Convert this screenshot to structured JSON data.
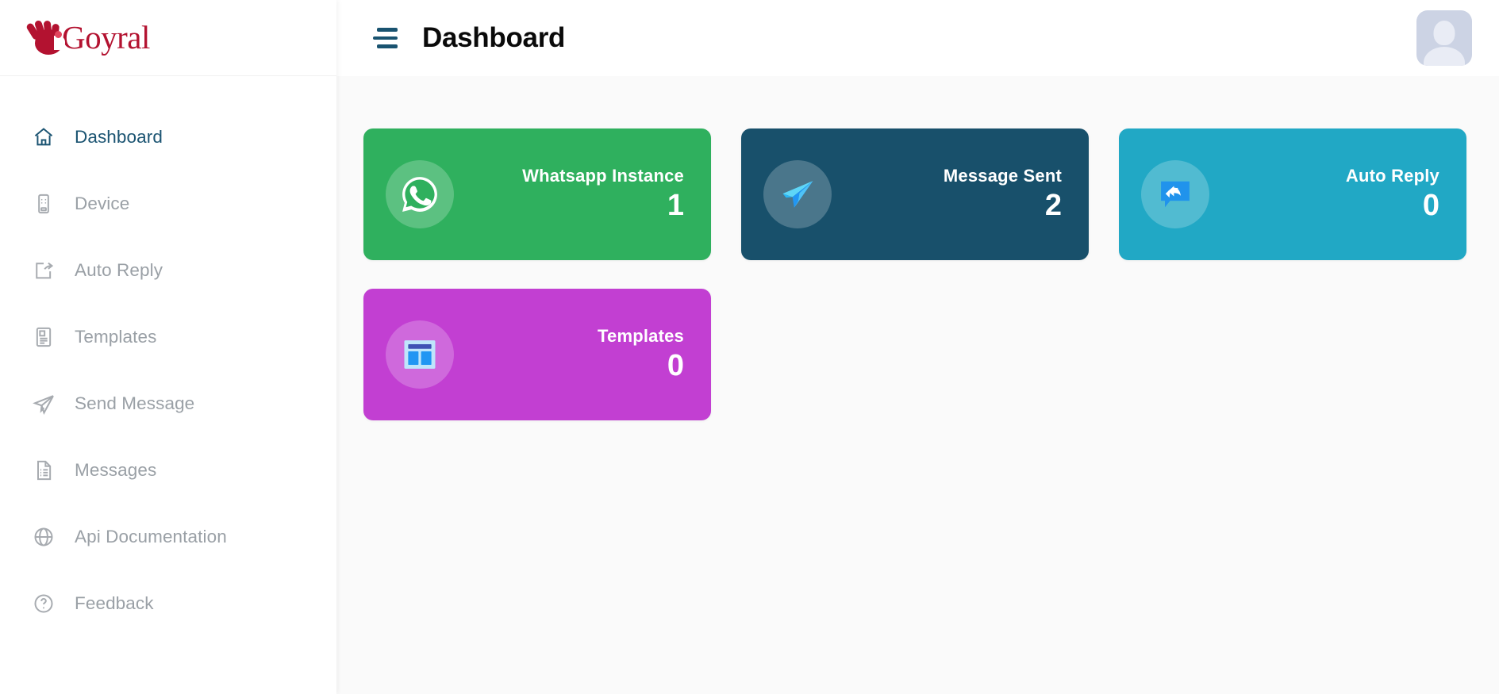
{
  "brand": {
    "name": "Goyral",
    "logo_color": "#b31230"
  },
  "sidebar": {
    "items": [
      {
        "label": "Dashboard",
        "icon": "home-icon",
        "active": true
      },
      {
        "label": "Device",
        "icon": "mobile-icon",
        "active": false
      },
      {
        "label": "Auto Reply",
        "icon": "share-icon",
        "active": false
      },
      {
        "label": "Templates",
        "icon": "template-icon",
        "active": false
      },
      {
        "label": "Send Message",
        "icon": "paper-plane-icon",
        "active": false
      },
      {
        "label": "Messages",
        "icon": "document-icon",
        "active": false
      },
      {
        "label": "Api Documentation",
        "icon": "globe-icon",
        "active": false
      },
      {
        "label": "Feedback",
        "icon": "question-circle-icon",
        "active": false
      }
    ]
  },
  "header": {
    "title": "Dashboard",
    "menu_toggle": "hamburger-icon",
    "avatar": "user-avatar"
  },
  "main": {
    "cards": [
      {
        "label": "Whatsapp Instance",
        "value": "1",
        "color": "#2fb05e",
        "icon": "whatsapp-icon"
      },
      {
        "label": "Message Sent",
        "value": "2",
        "color": "#18506b",
        "icon": "telegram-plane-icon"
      },
      {
        "label": "Auto Reply",
        "value": "0",
        "color": "#21a8c5",
        "icon": "reply-bubble-icon"
      },
      {
        "label": "Templates",
        "value": "0",
        "color": "#c23fd2",
        "icon": "layout-template-icon"
      }
    ]
  },
  "theme": {
    "active_nav": "#1b5472",
    "inactive_nav": "#9aa0a6",
    "content_bg": "#fafafa"
  }
}
